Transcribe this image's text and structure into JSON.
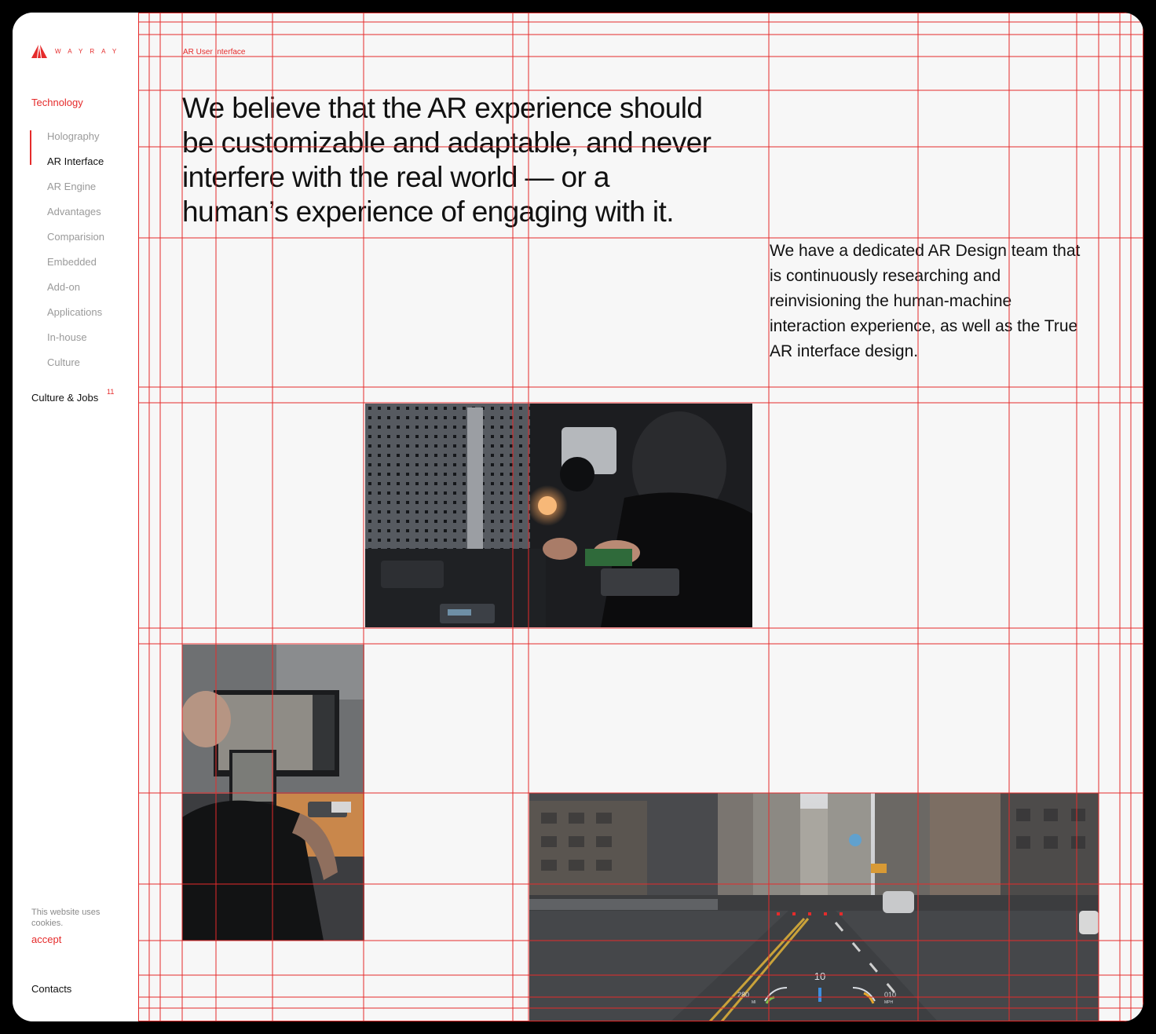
{
  "brand": {
    "name": "WAYRAY",
    "accent": "#e52b2b"
  },
  "nav": {
    "section_label": "Technology",
    "items": [
      {
        "label": "Holography"
      },
      {
        "label": "AR Interface",
        "active": true
      },
      {
        "label": "AR Engine"
      },
      {
        "label": "Advantages"
      },
      {
        "label": "Comparision"
      },
      {
        "label": "Embedded"
      },
      {
        "label": "Add-on"
      },
      {
        "label": "Applications"
      },
      {
        "label": "In-house"
      },
      {
        "label": "Culture"
      }
    ],
    "culture_jobs": {
      "label": "Culture & Jobs",
      "count": "11"
    }
  },
  "cookie": {
    "text": "This website uses cookies.",
    "accept_label": "accept"
  },
  "footer": {
    "contacts_label": "Contacts"
  },
  "content": {
    "eyebrow": "AR User Interface",
    "headline": "We believe that the AR experience should be customizable and adaptable, and never interfere with the real world — or a human’s experience of engaging with it.",
    "side_copy": "We have a dedicated AR Design team that is continuously researching and reinvisioning the human-machine interaction experience, as well as the True AR interface design."
  },
  "hud": {
    "speed": "10",
    "left_value": "280",
    "left_unit": "MI",
    "right_value": "010",
    "right_unit": "MPH"
  },
  "grid_color": "#e52b2b"
}
